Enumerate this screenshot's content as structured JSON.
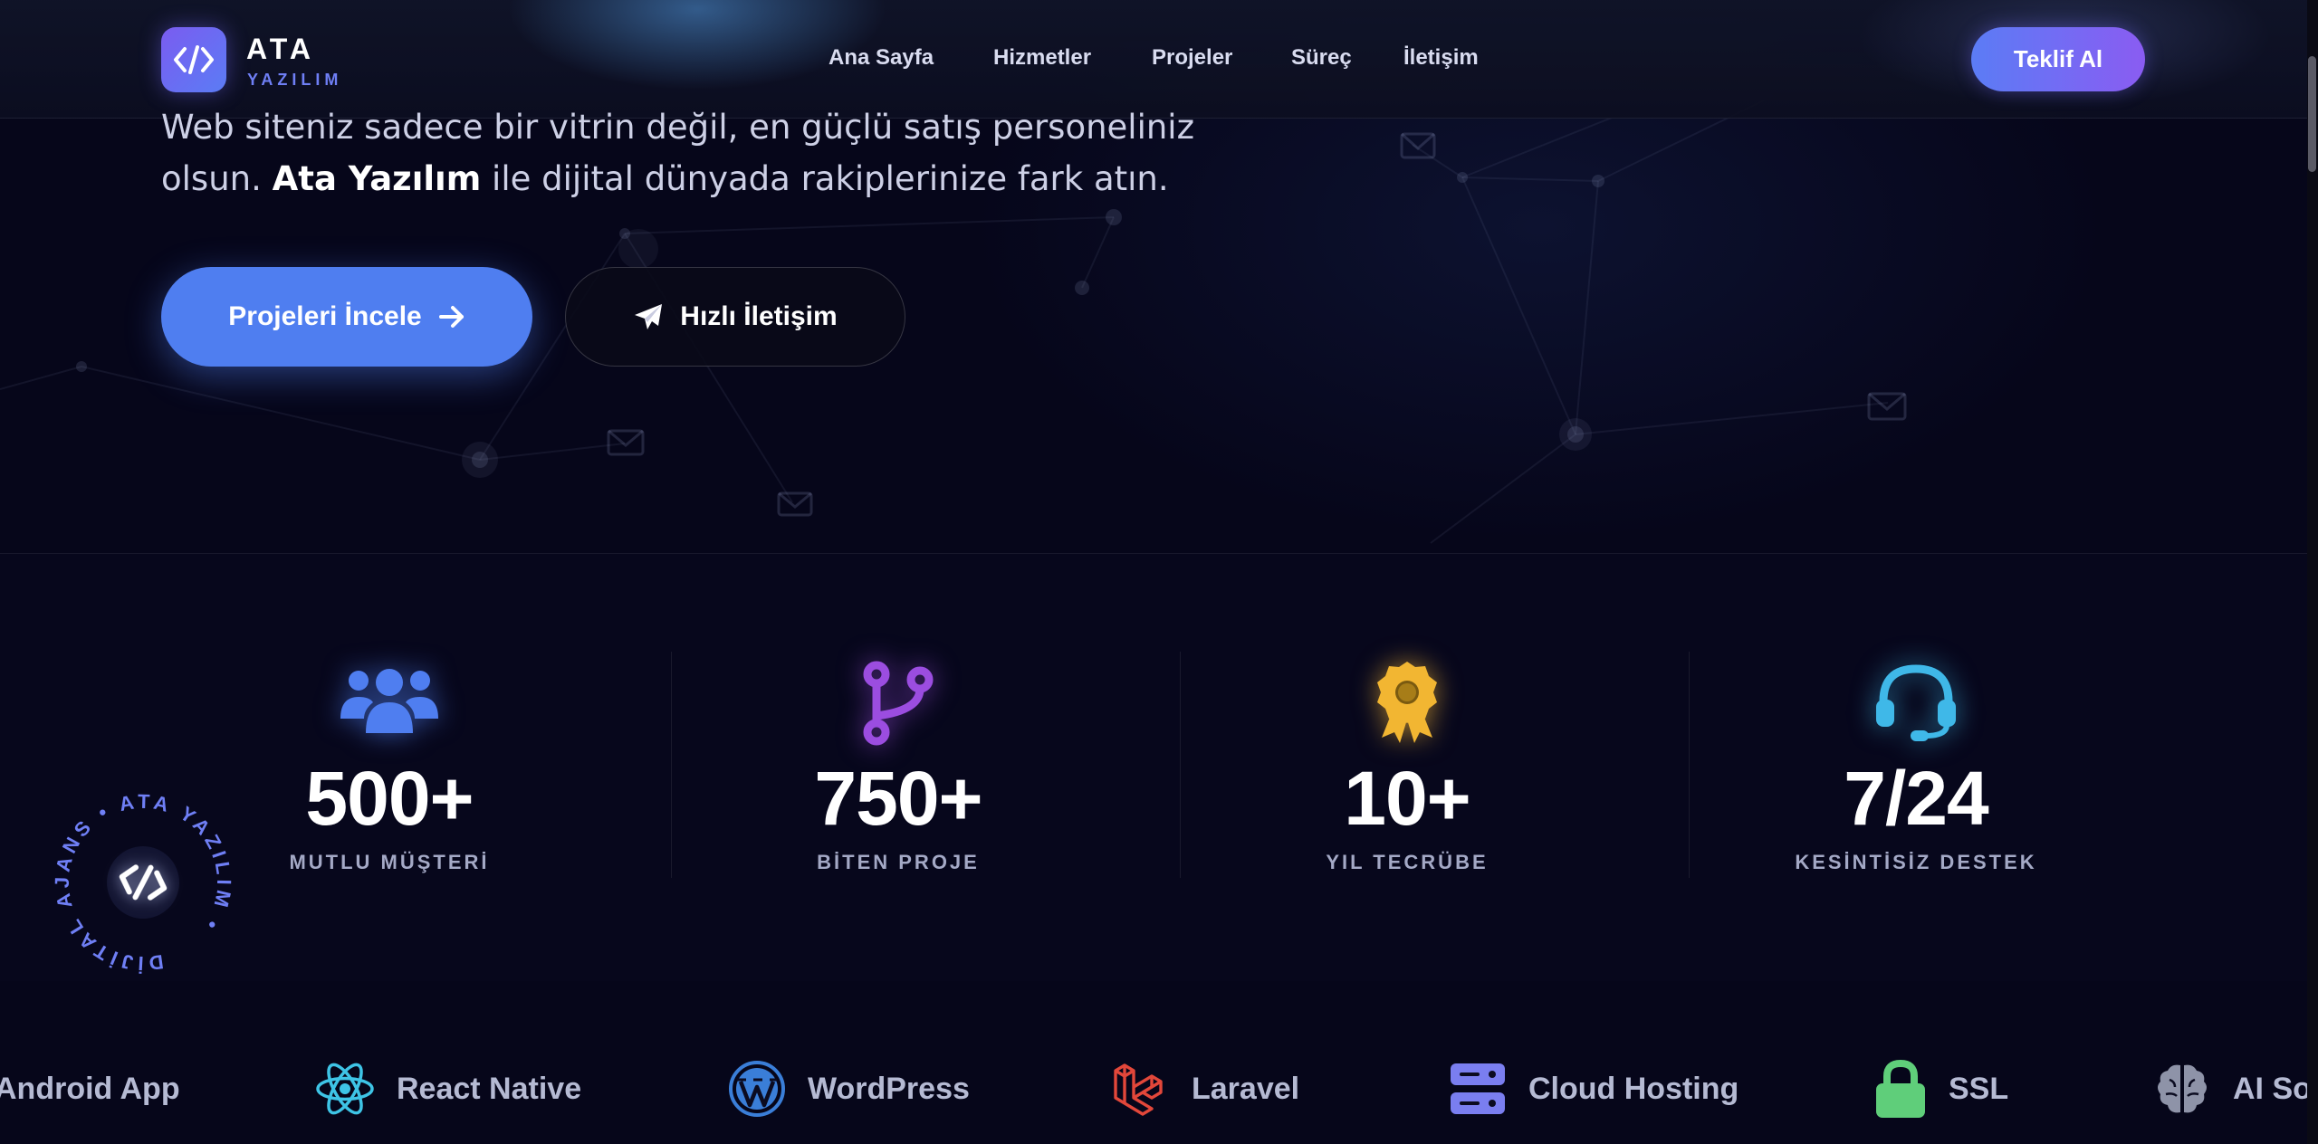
{
  "brand": {
    "name": "ATA",
    "tagline": "YAZILIM"
  },
  "nav": {
    "items": [
      {
        "label": "Ana Sayfa"
      },
      {
        "label": "Hizmetler"
      },
      {
        "label": "Projeler"
      },
      {
        "label": "Süreç"
      },
      {
        "label": "İletişim"
      }
    ],
    "cta_label": "Teklif Al"
  },
  "hero": {
    "line1": "Web siteniz sadece bir vitrin değil, en güçlü satış personeliniz",
    "line2_prefix": "olsun. ",
    "line2_brand": "Ata Yazılım",
    "line2_suffix": " ile dijital dünyada rakiplerinize fark atın.",
    "primary_button": "Projeleri İncele",
    "secondary_button": "Hızlı İletişim"
  },
  "stats": [
    {
      "icon": "users-icon",
      "value": "500+",
      "label": "MUTLU MÜŞTERİ",
      "color": "#4f7ef0"
    },
    {
      "icon": "code-branch-icon",
      "value": "750+",
      "label": "BİTEN PROJE",
      "color": "#9b4de0"
    },
    {
      "icon": "award-icon",
      "value": "10+",
      "label": "YIL TECRÜBE",
      "color": "#f2b632"
    },
    {
      "icon": "headset-icon",
      "value": "7/24",
      "label": "KESİNTİSİZ DESTEK",
      "color": "#3fb8e8"
    }
  ],
  "badge": {
    "text": "DİJİTAL AJANS • ATA YAZILIM •"
  },
  "tech": [
    {
      "label": "Android App",
      "icon": "android-icon"
    },
    {
      "label": "React Native",
      "icon": "react-icon",
      "color": "#3ec4e6"
    },
    {
      "label": "WordPress",
      "icon": "wordpress-icon",
      "color": "#3a7ed8"
    },
    {
      "label": "Laravel",
      "icon": "laravel-icon",
      "color": "#e2473a"
    },
    {
      "label": "Cloud Hosting",
      "icon": "server-icon",
      "color": "#7a7ef0"
    },
    {
      "label": "SSL",
      "icon": "lock-icon",
      "color": "#5fce7a"
    },
    {
      "label": "AI So",
      "icon": "brain-icon",
      "color": "#8e93a8"
    }
  ]
}
